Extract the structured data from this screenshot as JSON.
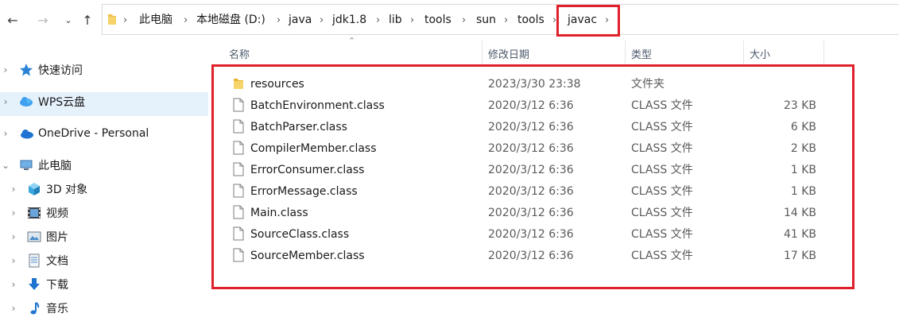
{
  "nav": {
    "back_icon": "arrow-left-icon",
    "forward_icon": "arrow-right-icon",
    "recent_icon": "chevron-down-icon",
    "up_icon": "arrow-up-icon"
  },
  "breadcrumb": [
    "此电脑",
    "本地磁盘 (D:)",
    "java",
    "jdk1.8",
    "lib",
    "tools",
    "sun",
    "tools",
    "javac"
  ],
  "sidebar": {
    "items": [
      {
        "label": "快速访问",
        "icon": "star-icon"
      },
      {
        "label": "WPS云盘",
        "icon": "cloud-icon"
      },
      {
        "label": "OneDrive - Personal",
        "icon": "onedrive-icon"
      },
      {
        "label": "此电脑",
        "icon": "computer-icon"
      },
      {
        "label": "3D 对象",
        "icon": "cube-icon"
      },
      {
        "label": "视频",
        "icon": "film-icon"
      },
      {
        "label": "图片",
        "icon": "image-icon"
      },
      {
        "label": "文档",
        "icon": "document-icon"
      },
      {
        "label": "下载",
        "icon": "download-icon"
      },
      {
        "label": "音乐",
        "icon": "music-icon"
      }
    ]
  },
  "columns": {
    "name": "名称",
    "date": "修改日期",
    "type": "类型",
    "size": "大小"
  },
  "files": [
    {
      "name": "resources",
      "date": "2023/3/30 23:38",
      "type": "文件夹",
      "size": "",
      "icon": "folder-icon"
    },
    {
      "name": "BatchEnvironment.class",
      "date": "2020/3/12 6:36",
      "type": "CLASS 文件",
      "size": "23 KB",
      "icon": "file-icon"
    },
    {
      "name": "BatchParser.class",
      "date": "2020/3/12 6:36",
      "type": "CLASS 文件",
      "size": "6 KB",
      "icon": "file-icon"
    },
    {
      "name": "CompilerMember.class",
      "date": "2020/3/12 6:36",
      "type": "CLASS 文件",
      "size": "2 KB",
      "icon": "file-icon"
    },
    {
      "name": "ErrorConsumer.class",
      "date": "2020/3/12 6:36",
      "type": "CLASS 文件",
      "size": "1 KB",
      "icon": "file-icon"
    },
    {
      "name": "ErrorMessage.class",
      "date": "2020/3/12 6:36",
      "type": "CLASS 文件",
      "size": "1 KB",
      "icon": "file-icon"
    },
    {
      "name": "Main.class",
      "date": "2020/3/12 6:36",
      "type": "CLASS 文件",
      "size": "14 KB",
      "icon": "file-icon"
    },
    {
      "name": "SourceClass.class",
      "date": "2020/3/12 6:36",
      "type": "CLASS 文件",
      "size": "41 KB",
      "icon": "file-icon"
    },
    {
      "name": "SourceMember.class",
      "date": "2020/3/12 6:36",
      "type": "CLASS 文件",
      "size": "17 KB",
      "icon": "file-icon"
    }
  ],
  "colors": {
    "highlight_red": "#e0202a",
    "selection_blue": "#e5f1fb",
    "folder_yellow": "#f0c24f"
  }
}
